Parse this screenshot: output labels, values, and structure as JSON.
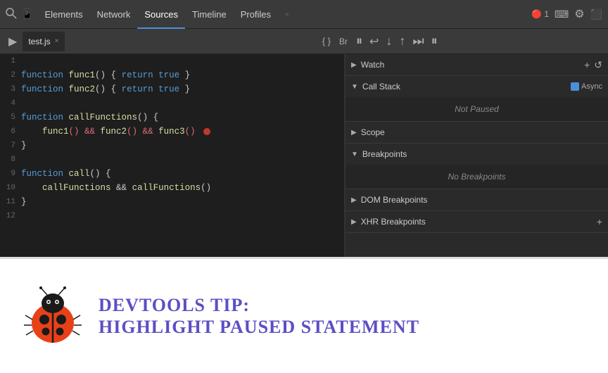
{
  "nav": {
    "items": [
      {
        "label": "Elements",
        "active": false
      },
      {
        "label": "Network",
        "active": false
      },
      {
        "label": "Sources",
        "active": true
      },
      {
        "label": "Timeline",
        "active": false
      },
      {
        "label": "Profiles",
        "active": false
      }
    ],
    "right": {
      "counter": "1",
      "console_label": ">_"
    }
  },
  "toolbar": {
    "tab_label": "test.js",
    "tab_close": "×"
  },
  "code": {
    "lines": [
      {
        "num": "1",
        "content": ""
      },
      {
        "num": "2",
        "content": "function func1() { return true }"
      },
      {
        "num": "3",
        "content": "function func2() { return true }"
      },
      {
        "num": "4",
        "content": ""
      },
      {
        "num": "5",
        "content": "function callFunctions() {"
      },
      {
        "num": "6",
        "content": "    func1() && func2() && func3()"
      },
      {
        "num": "7",
        "content": "}"
      },
      {
        "num": "8",
        "content": ""
      },
      {
        "num": "9",
        "content": "function call() {"
      },
      {
        "num": "10",
        "content": "    callFunctions && callFunctions()"
      },
      {
        "num": "11",
        "content": "}"
      },
      {
        "num": "12",
        "content": ""
      }
    ]
  },
  "right_panel": {
    "sections": [
      {
        "id": "watch",
        "label": "Watch",
        "collapsed": false,
        "actions": [
          "+",
          "↺"
        ],
        "content": null
      },
      {
        "id": "call-stack",
        "label": "Call Stack",
        "collapsed": false,
        "actions": [],
        "async_label": "Async",
        "content": "Not Paused"
      },
      {
        "id": "scope",
        "label": "Scope",
        "collapsed": true,
        "actions": [],
        "content": null
      },
      {
        "id": "breakpoints",
        "label": "Breakpoints",
        "collapsed": false,
        "actions": [],
        "content": "No Breakpoints"
      },
      {
        "id": "dom-breakpoints",
        "label": "DOM Breakpoints",
        "collapsed": true,
        "actions": [],
        "content": null
      },
      {
        "id": "xhr-breakpoints",
        "label": "XHR Breakpoints",
        "collapsed": true,
        "actions": [
          "+"
        ],
        "content": null
      }
    ]
  },
  "tip": {
    "title": "DevTools Tip:",
    "subtitle": "Highlight Paused Statement"
  }
}
